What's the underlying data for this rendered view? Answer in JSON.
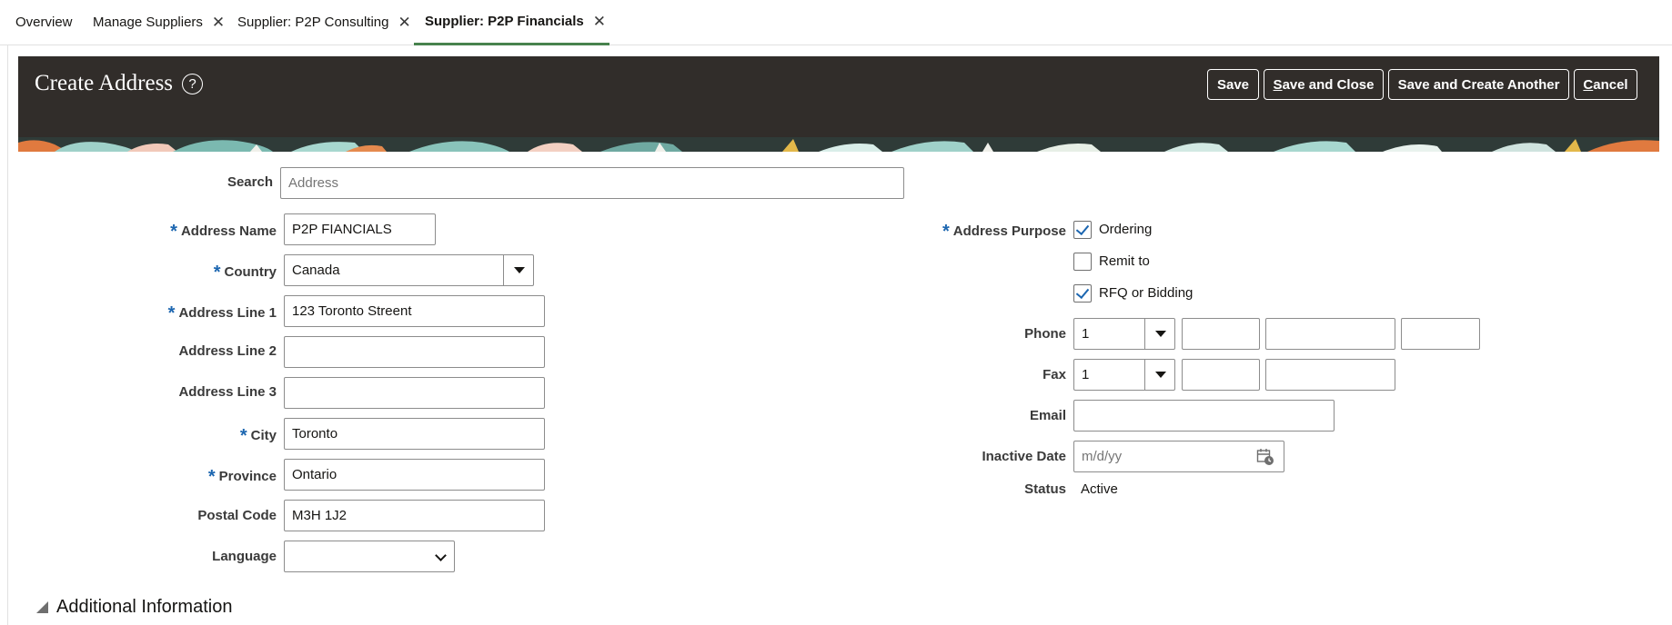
{
  "tabs": [
    {
      "label": "Overview"
    },
    {
      "label": "Manage Suppliers"
    },
    {
      "label": "Supplier: P2P Consulting"
    },
    {
      "label": "Supplier: P2P Financials"
    }
  ],
  "header": {
    "title": "Create Address",
    "help_symbol": "?",
    "buttons": {
      "save": "Save",
      "save_close_key": "S",
      "save_close_rest": "ave and Close",
      "save_create_another": "Save and Create Another",
      "cancel_key": "C",
      "cancel_rest": "ancel"
    },
    "background_color": "#312d2a"
  },
  "form": {
    "search_label": "Search",
    "search_placeholder": "Address",
    "address_name_label": "Address Name",
    "address_name_value": "P2P FIANCIALS",
    "country_label": "Country",
    "country_value": "Canada",
    "address_line1_label": "Address Line 1",
    "address_line1_value": "123 Toronto Streent",
    "address_line2_label": "Address Line 2",
    "address_line2_value": "",
    "address_line3_label": "Address Line 3",
    "address_line3_value": "",
    "city_label": "City",
    "city_value": "Toronto",
    "province_label": "Province",
    "province_value": "Ontario",
    "postal_code_label": "Postal Code",
    "postal_code_value": "M3H 1J2",
    "language_label": "Language",
    "language_value": "",
    "address_purpose_label": "Address Purpose",
    "purposes": [
      {
        "label": "Ordering",
        "checked": true
      },
      {
        "label": "Remit to",
        "checked": false
      },
      {
        "label": "RFQ or Bidding",
        "checked": true
      }
    ],
    "phone_label": "Phone",
    "phone_country_code": "1",
    "fax_label": "Fax",
    "fax_country_code": "1",
    "email_label": "Email",
    "email_value": "",
    "inactive_date_label": "Inactive Date",
    "inactive_date_placeholder": "m/d/yy",
    "status_label": "Status",
    "status_value": "Active",
    "required_marker": "*"
  },
  "sections": {
    "additional_information": "Additional Information"
  },
  "icons": {
    "help": "help-circle-icon",
    "close": "close-icon",
    "dropdown": "dropdown-triangle-icon",
    "calendar": "calendar-icon",
    "disclosure": "disclosure-triangle-icon"
  },
  "colors": {
    "accent_required": "#1c66b0",
    "tab_underline": "#47824d"
  }
}
